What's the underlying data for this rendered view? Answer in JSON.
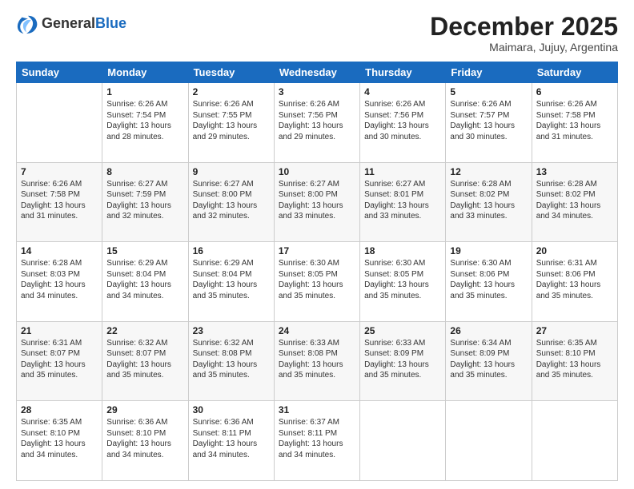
{
  "logo": {
    "general": "General",
    "blue": "Blue"
  },
  "header": {
    "month": "December 2025",
    "location": "Maimara, Jujuy, Argentina"
  },
  "weekdays": [
    "Sunday",
    "Monday",
    "Tuesday",
    "Wednesday",
    "Thursday",
    "Friday",
    "Saturday"
  ],
  "weeks": [
    [
      {
        "day": "",
        "info": ""
      },
      {
        "day": "1",
        "info": "Sunrise: 6:26 AM\nSunset: 7:54 PM\nDaylight: 13 hours\nand 28 minutes."
      },
      {
        "day": "2",
        "info": "Sunrise: 6:26 AM\nSunset: 7:55 PM\nDaylight: 13 hours\nand 29 minutes."
      },
      {
        "day": "3",
        "info": "Sunrise: 6:26 AM\nSunset: 7:56 PM\nDaylight: 13 hours\nand 29 minutes."
      },
      {
        "day": "4",
        "info": "Sunrise: 6:26 AM\nSunset: 7:56 PM\nDaylight: 13 hours\nand 30 minutes."
      },
      {
        "day": "5",
        "info": "Sunrise: 6:26 AM\nSunset: 7:57 PM\nDaylight: 13 hours\nand 30 minutes."
      },
      {
        "day": "6",
        "info": "Sunrise: 6:26 AM\nSunset: 7:58 PM\nDaylight: 13 hours\nand 31 minutes."
      }
    ],
    [
      {
        "day": "7",
        "info": "Sunrise: 6:26 AM\nSunset: 7:58 PM\nDaylight: 13 hours\nand 31 minutes."
      },
      {
        "day": "8",
        "info": "Sunrise: 6:27 AM\nSunset: 7:59 PM\nDaylight: 13 hours\nand 32 minutes."
      },
      {
        "day": "9",
        "info": "Sunrise: 6:27 AM\nSunset: 8:00 PM\nDaylight: 13 hours\nand 32 minutes."
      },
      {
        "day": "10",
        "info": "Sunrise: 6:27 AM\nSunset: 8:00 PM\nDaylight: 13 hours\nand 33 minutes."
      },
      {
        "day": "11",
        "info": "Sunrise: 6:27 AM\nSunset: 8:01 PM\nDaylight: 13 hours\nand 33 minutes."
      },
      {
        "day": "12",
        "info": "Sunrise: 6:28 AM\nSunset: 8:02 PM\nDaylight: 13 hours\nand 33 minutes."
      },
      {
        "day": "13",
        "info": "Sunrise: 6:28 AM\nSunset: 8:02 PM\nDaylight: 13 hours\nand 34 minutes."
      }
    ],
    [
      {
        "day": "14",
        "info": "Sunrise: 6:28 AM\nSunset: 8:03 PM\nDaylight: 13 hours\nand 34 minutes."
      },
      {
        "day": "15",
        "info": "Sunrise: 6:29 AM\nSunset: 8:04 PM\nDaylight: 13 hours\nand 34 minutes."
      },
      {
        "day": "16",
        "info": "Sunrise: 6:29 AM\nSunset: 8:04 PM\nDaylight: 13 hours\nand 35 minutes."
      },
      {
        "day": "17",
        "info": "Sunrise: 6:30 AM\nSunset: 8:05 PM\nDaylight: 13 hours\nand 35 minutes."
      },
      {
        "day": "18",
        "info": "Sunrise: 6:30 AM\nSunset: 8:05 PM\nDaylight: 13 hours\nand 35 minutes."
      },
      {
        "day": "19",
        "info": "Sunrise: 6:30 AM\nSunset: 8:06 PM\nDaylight: 13 hours\nand 35 minutes."
      },
      {
        "day": "20",
        "info": "Sunrise: 6:31 AM\nSunset: 8:06 PM\nDaylight: 13 hours\nand 35 minutes."
      }
    ],
    [
      {
        "day": "21",
        "info": "Sunrise: 6:31 AM\nSunset: 8:07 PM\nDaylight: 13 hours\nand 35 minutes."
      },
      {
        "day": "22",
        "info": "Sunrise: 6:32 AM\nSunset: 8:07 PM\nDaylight: 13 hours\nand 35 minutes."
      },
      {
        "day": "23",
        "info": "Sunrise: 6:32 AM\nSunset: 8:08 PM\nDaylight: 13 hours\nand 35 minutes."
      },
      {
        "day": "24",
        "info": "Sunrise: 6:33 AM\nSunset: 8:08 PM\nDaylight: 13 hours\nand 35 minutes."
      },
      {
        "day": "25",
        "info": "Sunrise: 6:33 AM\nSunset: 8:09 PM\nDaylight: 13 hours\nand 35 minutes."
      },
      {
        "day": "26",
        "info": "Sunrise: 6:34 AM\nSunset: 8:09 PM\nDaylight: 13 hours\nand 35 minutes."
      },
      {
        "day": "27",
        "info": "Sunrise: 6:35 AM\nSunset: 8:10 PM\nDaylight: 13 hours\nand 35 minutes."
      }
    ],
    [
      {
        "day": "28",
        "info": "Sunrise: 6:35 AM\nSunset: 8:10 PM\nDaylight: 13 hours\nand 34 minutes."
      },
      {
        "day": "29",
        "info": "Sunrise: 6:36 AM\nSunset: 8:10 PM\nDaylight: 13 hours\nand 34 minutes."
      },
      {
        "day": "30",
        "info": "Sunrise: 6:36 AM\nSunset: 8:11 PM\nDaylight: 13 hours\nand 34 minutes."
      },
      {
        "day": "31",
        "info": "Sunrise: 6:37 AM\nSunset: 8:11 PM\nDaylight: 13 hours\nand 34 minutes."
      },
      {
        "day": "",
        "info": ""
      },
      {
        "day": "",
        "info": ""
      },
      {
        "day": "",
        "info": ""
      }
    ]
  ]
}
